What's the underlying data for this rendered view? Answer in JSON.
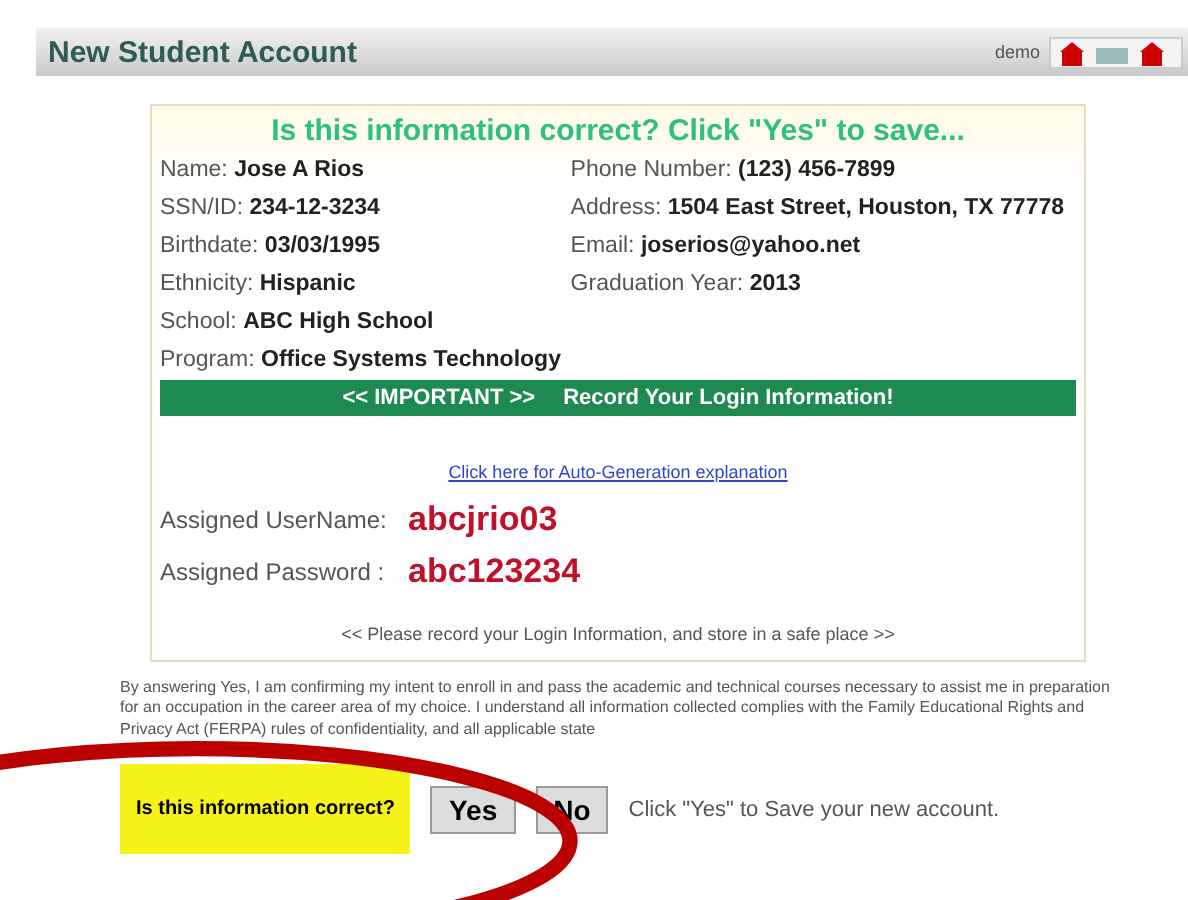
{
  "header": {
    "title": "New Student Account",
    "user": "demo"
  },
  "info_box": {
    "heading": "Is this information correct? Click \"Yes\" to save...",
    "left_fields": [
      {
        "label": "Name:",
        "value": "Jose A Rios"
      },
      {
        "label": "SSN/ID:",
        "value": "234-12-3234"
      },
      {
        "label": "Birthdate:",
        "value": "03/03/1995"
      },
      {
        "label": "Ethnicity:",
        "value": "Hispanic"
      },
      {
        "label": "School:",
        "value": "ABC High School"
      },
      {
        "label": "Program:",
        "value": "Office Systems Technology"
      }
    ],
    "right_fields": [
      {
        "label": "Phone Number:",
        "value": "(123) 456-7899"
      },
      {
        "label": "Address:",
        "value": "1504 East Street, Houston, TX  77778"
      },
      {
        "label": "Email:",
        "value": "joserios@yahoo.net"
      },
      {
        "label": "Graduation Year:",
        "value": "2013"
      }
    ],
    "banner": {
      "tag": "<< IMPORTANT >>",
      "text": "Record Your Login Information!"
    },
    "link": "Click here for Auto-Generation explanation",
    "credentials": [
      {
        "label": "Assigned UserName:",
        "value": "abcjrio03"
      },
      {
        "label": "Assigned Password :",
        "value": "abc123234"
      }
    ],
    "note": "<< Please record your Login Information, and store in a safe place >>"
  },
  "disclaimer": "By answering Yes, I am confirming my intent to enroll in and pass the academic and technical courses necessary to assist me in preparation for an occupation in the career area of my choice. I understand all information collected complies with the Family Educational Rights and Privacy Act (FERPA) rules of confidentiality, and all applicable state",
  "confirm": {
    "question": "Is this information correct?",
    "buttons": [
      "Yes",
      "No"
    ],
    "hint": "Click \"Yes\" to Save your new account."
  }
}
